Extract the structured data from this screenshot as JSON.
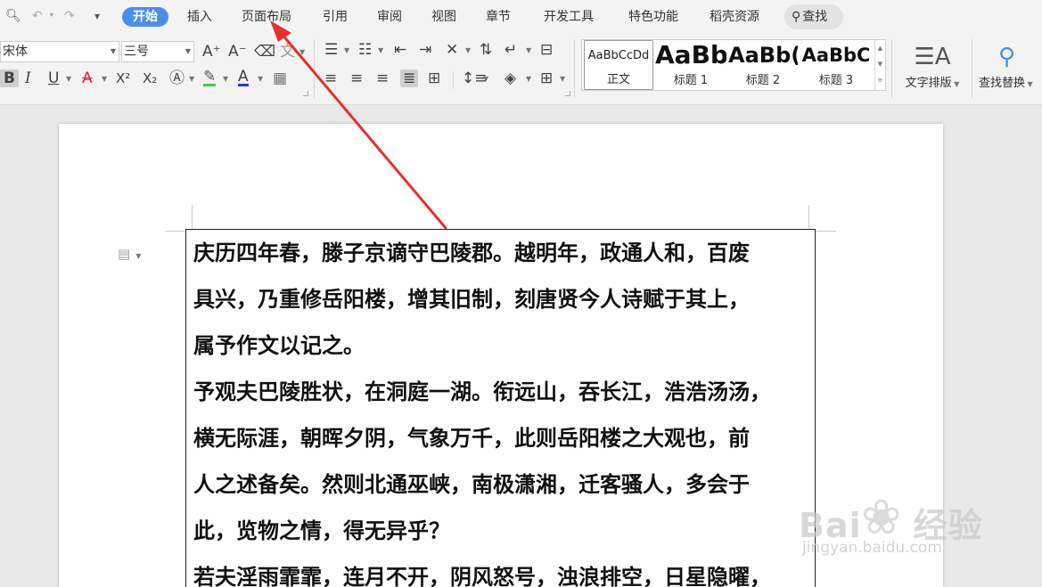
{
  "quick_access": {
    "preview_icon": "print-preview-icon",
    "undo_icon": "undo-icon",
    "redo_icon": "redo-icon",
    "customize_icon": "customize-icon"
  },
  "menu_tabs": [
    {
      "label": "开始",
      "active": true
    },
    {
      "label": "插入"
    },
    {
      "label": "页面布局"
    },
    {
      "label": "引用"
    },
    {
      "label": "审阅"
    },
    {
      "label": "视图"
    },
    {
      "label": "章节"
    },
    {
      "label": "开发工具"
    },
    {
      "label": "特色功能"
    },
    {
      "label": "稻壳资源"
    }
  ],
  "search_tab": {
    "label": "查找"
  },
  "font": {
    "name": "宋体",
    "size": "三号"
  },
  "format_buttons": {
    "bold": "B",
    "italic": "I",
    "underline": "U",
    "strikethrough": "A",
    "superscript": "X²",
    "subscript": "X₂",
    "font_color": "A",
    "highlight": "✎"
  },
  "styles_gallery": [
    {
      "preview": "AaBbCcDd",
      "label": "正文"
    },
    {
      "preview": "AaBb",
      "label": "标题 1"
    },
    {
      "preview": "AaBb(",
      "label": "标题 2"
    },
    {
      "preview": "AaBbC",
      "label": "标题 3"
    }
  ],
  "big_buttons": {
    "text_layout": "文字排版",
    "find_replace": "查找替换"
  },
  "document": {
    "lines": [
      "庆历四年春，滕子京谪守巴陵郡。越明年，政通人和，百废",
      "具兴，乃重修岳阳楼，增其旧制，刻唐贤今人诗赋于其上，",
      "属予作文以记之。",
      "予观夫巴陵胜状，在洞庭一湖。衔远山，吞长江，浩浩汤汤，",
      "横无际涯，朝晖夕阴，气象万千，此则岳阳楼之大观也，前",
      "人之述备矣。然则北通巫峡，南极潇湘，迁客骚人，多会于",
      "此，览物之情，得无异乎？",
      "若夫淫雨霏霏，连月不开，阴风怒号，浊浪排空，日星隐曜，"
    ]
  },
  "annotation": {
    "color": "#e8302a"
  },
  "watermark": {
    "brand": "Bai",
    "brand_tail": "经验",
    "url": "jingyan.baidu.com"
  },
  "colors": {
    "accent": "#4d8fe8",
    "ribbon_bg": "#f3f3f3",
    "canvas_bg": "#e9e9e9"
  }
}
